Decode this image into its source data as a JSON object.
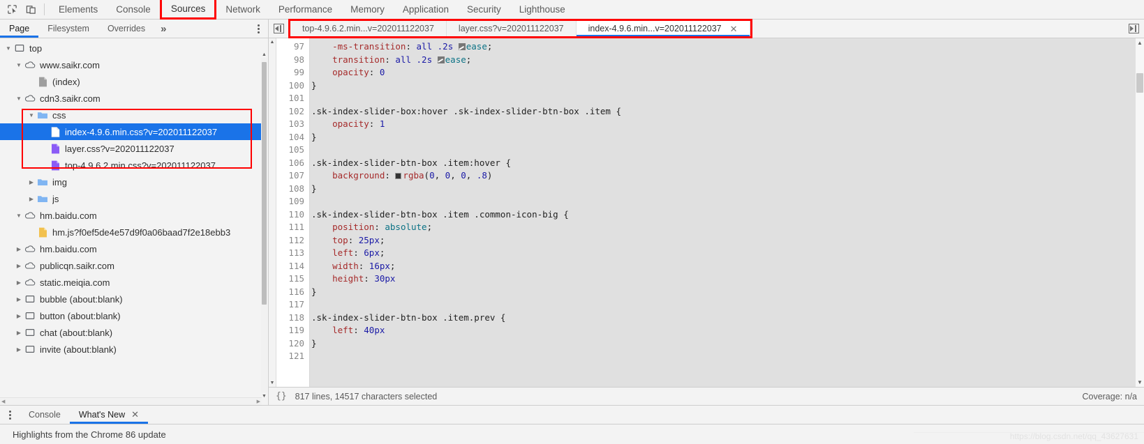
{
  "toolbar": {
    "icons": [
      {
        "name": "inspect-element-icon",
        "glyph": "inspect"
      },
      {
        "name": "device-toolbar-icon",
        "glyph": "device"
      }
    ],
    "panels": [
      {
        "label": "Elements",
        "active": false,
        "highlighted": false
      },
      {
        "label": "Console",
        "active": false,
        "highlighted": false
      },
      {
        "label": "Sources",
        "active": true,
        "highlighted": true
      },
      {
        "label": "Network",
        "active": false,
        "highlighted": false
      },
      {
        "label": "Performance",
        "active": false,
        "highlighted": false
      },
      {
        "label": "Memory",
        "active": false,
        "highlighted": false
      },
      {
        "label": "Application",
        "active": false,
        "highlighted": false
      },
      {
        "label": "Security",
        "active": false,
        "highlighted": false
      },
      {
        "label": "Lighthouse",
        "active": false,
        "highlighted": false
      }
    ]
  },
  "navigator": {
    "tabs": [
      {
        "label": "Page",
        "active": true
      },
      {
        "label": "Filesystem",
        "active": false
      },
      {
        "label": "Overrides",
        "active": false
      }
    ],
    "more_label": "»",
    "more_options_title": "More options",
    "tree": [
      {
        "label": "top",
        "indent": 0,
        "icon": "frame",
        "twist": "open",
        "selected": false,
        "boxed": false
      },
      {
        "label": "www.saikr.com",
        "indent": 1,
        "icon": "cloud",
        "twist": "open",
        "selected": false,
        "boxed": false
      },
      {
        "label": "(index)",
        "indent": 2,
        "icon": "doc-gray",
        "twist": "none",
        "selected": false,
        "boxed": false
      },
      {
        "label": "cdn3.saikr.com",
        "indent": 1,
        "icon": "cloud",
        "twist": "open",
        "selected": false,
        "boxed": false
      },
      {
        "label": "css",
        "indent": 2,
        "icon": "folder",
        "twist": "open",
        "selected": false,
        "boxed": true
      },
      {
        "label": "index-4.9.6.min.css?v=202011122037",
        "indent": 3,
        "icon": "doc-white",
        "twist": "none",
        "selected": true,
        "boxed": true
      },
      {
        "label": "layer.css?v=202011122037",
        "indent": 3,
        "icon": "doc-purple",
        "twist": "none",
        "selected": false,
        "boxed": true
      },
      {
        "label": "top-4.9.6.2.min.css?v=202011122037",
        "indent": 3,
        "icon": "doc-purple",
        "twist": "none",
        "selected": false,
        "boxed": true
      },
      {
        "label": "img",
        "indent": 2,
        "icon": "folder",
        "twist": "closed",
        "selected": false,
        "boxed": false
      },
      {
        "label": "js",
        "indent": 2,
        "icon": "folder",
        "twist": "closed",
        "selected": false,
        "boxed": false
      },
      {
        "label": "hm.baidu.com",
        "indent": 1,
        "icon": "cloud",
        "twist": "open",
        "selected": false,
        "boxed": false
      },
      {
        "label": "hm.js?f0ef5de4e57d9f0a06baad7f2e18ebb3",
        "indent": 2,
        "icon": "doc-yellow",
        "twist": "none",
        "selected": false,
        "boxed": false
      },
      {
        "label": "hm.baidu.com",
        "indent": 1,
        "icon": "cloud",
        "twist": "closed",
        "selected": false,
        "boxed": false
      },
      {
        "label": "publicqn.saikr.com",
        "indent": 1,
        "icon": "cloud",
        "twist": "closed",
        "selected": false,
        "boxed": false
      },
      {
        "label": "static.meiqia.com",
        "indent": 1,
        "icon": "cloud",
        "twist": "closed",
        "selected": false,
        "boxed": false
      },
      {
        "label": "bubble (about:blank)",
        "indent": 1,
        "icon": "frame",
        "twist": "closed",
        "selected": false,
        "boxed": false
      },
      {
        "label": "button (about:blank)",
        "indent": 1,
        "icon": "frame",
        "twist": "closed",
        "selected": false,
        "boxed": false
      },
      {
        "label": "chat (about:blank)",
        "indent": 1,
        "icon": "frame",
        "twist": "closed",
        "selected": false,
        "boxed": false
      },
      {
        "label": "invite (about:blank)",
        "indent": 1,
        "icon": "frame",
        "twist": "closed",
        "selected": false,
        "boxed": false
      }
    ]
  },
  "editor": {
    "tabs": [
      {
        "label": "top-4.9.6.2.min...v=202011122037",
        "active": false,
        "closable": false
      },
      {
        "label": "layer.css?v=202011122037",
        "active": false,
        "closable": false
      },
      {
        "label": "index-4.9.6.min...v=202011122037",
        "active": true,
        "closable": true
      }
    ],
    "close_glyph": "✕",
    "first_line_number": 97,
    "last_line_number": 121,
    "code": [
      {
        "n": 97,
        "tokens": [
          {
            "t": "    -ms-transition",
            "c": "prop"
          },
          {
            "t": ": ",
            "c": "punc"
          },
          {
            "t": "all",
            "c": "val"
          },
          {
            "t": " ",
            "c": "punc"
          },
          {
            "t": ".2s",
            "c": "val"
          },
          {
            "t": " ",
            "c": "punc"
          },
          {
            "t": "EASE_SWATCH",
            "c": "easing"
          },
          {
            "t": "ease",
            "c": "kw"
          },
          {
            "t": ";",
            "c": "punc"
          }
        ]
      },
      {
        "n": 98,
        "tokens": [
          {
            "t": "    transition",
            "c": "prop"
          },
          {
            "t": ": ",
            "c": "punc"
          },
          {
            "t": "all",
            "c": "val"
          },
          {
            "t": " ",
            "c": "punc"
          },
          {
            "t": ".2s",
            "c": "val"
          },
          {
            "t": " ",
            "c": "punc"
          },
          {
            "t": "EASE_SWATCH",
            "c": "easing"
          },
          {
            "t": "ease",
            "c": "kw"
          },
          {
            "t": ";",
            "c": "punc"
          }
        ]
      },
      {
        "n": 99,
        "tokens": [
          {
            "t": "    opacity",
            "c": "prop"
          },
          {
            "t": ": ",
            "c": "punc"
          },
          {
            "t": "0",
            "c": "val"
          }
        ]
      },
      {
        "n": 100,
        "tokens": [
          {
            "t": "}",
            "c": "punc"
          }
        ]
      },
      {
        "n": 101,
        "tokens": []
      },
      {
        "n": 102,
        "tokens": [
          {
            "t": ".sk-index-slider-box:hover .sk-index-slider-btn-box .item {",
            "c": "sel"
          }
        ]
      },
      {
        "n": 103,
        "tokens": [
          {
            "t": "    opacity",
            "c": "prop"
          },
          {
            "t": ": ",
            "c": "punc"
          },
          {
            "t": "1",
            "c": "val"
          }
        ]
      },
      {
        "n": 104,
        "tokens": [
          {
            "t": "}",
            "c": "punc"
          }
        ]
      },
      {
        "n": 105,
        "tokens": []
      },
      {
        "n": 106,
        "tokens": [
          {
            "t": ".sk-index-slider-btn-box .item:hover {",
            "c": "sel"
          }
        ]
      },
      {
        "n": 107,
        "tokens": [
          {
            "t": "    background",
            "c": "prop"
          },
          {
            "t": ": ",
            "c": "punc"
          },
          {
            "t": "COLOR_SWATCH",
            "c": "swatch",
            "color": "#333333"
          },
          {
            "t": "rgba",
            "c": "prop"
          },
          {
            "t": "(",
            "c": "punc"
          },
          {
            "t": "0",
            "c": "val"
          },
          {
            "t": ", ",
            "c": "punc"
          },
          {
            "t": "0",
            "c": "val"
          },
          {
            "t": ", ",
            "c": "punc"
          },
          {
            "t": "0",
            "c": "val"
          },
          {
            "t": ", ",
            "c": "punc"
          },
          {
            "t": ".8",
            "c": "val"
          },
          {
            "t": ")",
            "c": "punc"
          }
        ]
      },
      {
        "n": 108,
        "tokens": [
          {
            "t": "}",
            "c": "punc"
          }
        ]
      },
      {
        "n": 109,
        "tokens": []
      },
      {
        "n": 110,
        "tokens": [
          {
            "t": ".sk-index-slider-btn-box .item .common-icon-big {",
            "c": "sel"
          }
        ]
      },
      {
        "n": 111,
        "tokens": [
          {
            "t": "    position",
            "c": "prop"
          },
          {
            "t": ": ",
            "c": "punc"
          },
          {
            "t": "absolute",
            "c": "kw"
          },
          {
            "t": ";",
            "c": "punc"
          }
        ]
      },
      {
        "n": 112,
        "tokens": [
          {
            "t": "    top",
            "c": "prop"
          },
          {
            "t": ": ",
            "c": "punc"
          },
          {
            "t": "25px",
            "c": "val"
          },
          {
            "t": ";",
            "c": "punc"
          }
        ]
      },
      {
        "n": 113,
        "tokens": [
          {
            "t": "    left",
            "c": "prop"
          },
          {
            "t": ": ",
            "c": "punc"
          },
          {
            "t": "6px",
            "c": "val"
          },
          {
            "t": ";",
            "c": "punc"
          }
        ]
      },
      {
        "n": 114,
        "tokens": [
          {
            "t": "    width",
            "c": "prop"
          },
          {
            "t": ": ",
            "c": "punc"
          },
          {
            "t": "16px",
            "c": "val"
          },
          {
            "t": ";",
            "c": "punc"
          }
        ]
      },
      {
        "n": 115,
        "tokens": [
          {
            "t": "    height",
            "c": "prop"
          },
          {
            "t": ": ",
            "c": "punc"
          },
          {
            "t": "30px",
            "c": "val"
          }
        ]
      },
      {
        "n": 116,
        "tokens": [
          {
            "t": "}",
            "c": "punc"
          }
        ]
      },
      {
        "n": 117,
        "tokens": []
      },
      {
        "n": 118,
        "tokens": [
          {
            "t": ".sk-index-slider-btn-box .item.prev {",
            "c": "sel"
          }
        ]
      },
      {
        "n": 119,
        "tokens": [
          {
            "t": "    left",
            "c": "prop"
          },
          {
            "t": ": ",
            "c": "punc"
          },
          {
            "t": "40px",
            "c": "val"
          }
        ]
      },
      {
        "n": 120,
        "tokens": [
          {
            "t": "}",
            "c": "punc"
          }
        ]
      },
      {
        "n": 121,
        "tokens": []
      }
    ],
    "status": {
      "pretty_print_icon": "{}",
      "selection_text": "817 lines, 14517 characters selected",
      "coverage_text": "Coverage: n/a"
    }
  },
  "drawer": {
    "tabs": [
      {
        "label": "Console",
        "active": false,
        "closable": false
      },
      {
        "label": "What's New",
        "active": true,
        "closable": true
      }
    ],
    "close_glyph": "✕",
    "content_text": "Highlights from the Chrome 86 update"
  },
  "watermark": {
    "text": "https://blog.csdn.net/qq_43627631"
  },
  "colors": {
    "accent": "#1a73e8",
    "highlight_box": "#ff0000",
    "toolbar_bg": "#f3f3f3",
    "code_bg": "#e0e0e0"
  }
}
